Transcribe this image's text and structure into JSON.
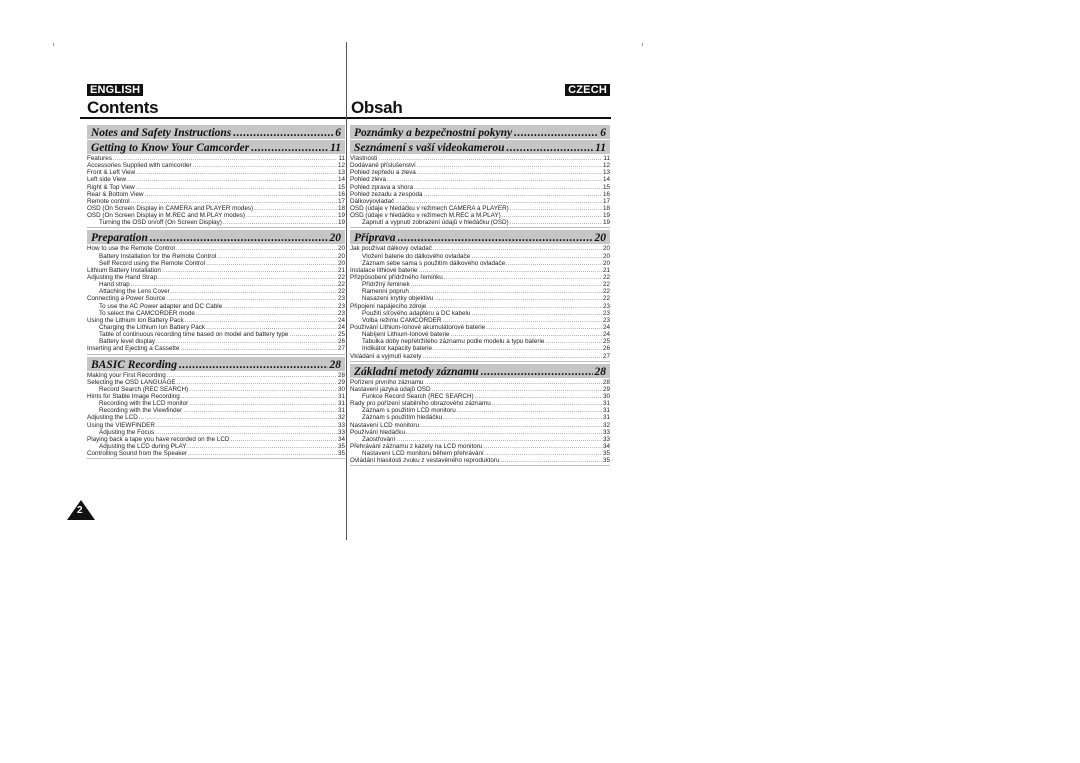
{
  "english": {
    "badge": "ENGLISH",
    "title": "Contents",
    "sections": [
      {
        "title": "Notes and Safety Instructions",
        "page": "6",
        "entries": []
      },
      {
        "title": "Getting to Know Your Camcorder",
        "page": "11",
        "entries": [
          {
            "text": "Features",
            "page": "11",
            "sub": false
          },
          {
            "text": "Accessories Supplied with camcorder",
            "page": "12",
            "sub": false
          },
          {
            "text": "Front & Left View",
            "page": "13",
            "sub": false
          },
          {
            "text": "Left side View",
            "page": "14",
            "sub": false
          },
          {
            "text": "Right & Top View",
            "page": "15",
            "sub": false
          },
          {
            "text": "Rear & Bottom View",
            "page": "16",
            "sub": false
          },
          {
            "text": "Remote control",
            "page": "17",
            "sub": false
          },
          {
            "text": "OSD (On Screen Display in CAMERA and PLAYER modes)",
            "page": "18",
            "sub": false
          },
          {
            "text": "OSD (On Screen Display in M.REC and M.PLAY modes)",
            "page": "19",
            "sub": false
          },
          {
            "text": "Turning the OSD on/off (On Screen Display)",
            "page": "19",
            "sub": true
          }
        ]
      },
      {
        "title": "Preparation",
        "page": "20",
        "entries": [
          {
            "text": "How to use the Remote Control",
            "page": "20",
            "sub": false
          },
          {
            "text": "Battery Installation for the Remote Control",
            "page": "20",
            "sub": true
          },
          {
            "text": "Self Record using the Remote Control",
            "page": "20",
            "sub": true
          },
          {
            "text": "Lithium Battery Installation",
            "page": "21",
            "sub": false
          },
          {
            "text": "Adjusting the Hand Strap",
            "page": "22",
            "sub": false
          },
          {
            "text": "Hand strap",
            "page": "22",
            "sub": true
          },
          {
            "text": "Attaching the Lens Cover",
            "page": "22",
            "sub": true
          },
          {
            "text": "Connecting a Power Source",
            "page": "23",
            "sub": false
          },
          {
            "text": "To use the AC Power adapter and DC Cable",
            "page": "23",
            "sub": true
          },
          {
            "text": "To select the CAMCORDER mode",
            "page": "23",
            "sub": true
          },
          {
            "text": "Using the Lithium Ion Battery Pack",
            "page": "24",
            "sub": false
          },
          {
            "text": "Charging the Lithium Ion Battery Pack",
            "page": "24",
            "sub": true
          },
          {
            "text": "Table of continuous recording time based on model and battery type",
            "page": "25",
            "sub": true
          },
          {
            "text": "Battery level display",
            "page": "26",
            "sub": true
          },
          {
            "text": "Inserting and Ejecting a Cassette",
            "page": "27",
            "sub": false
          }
        ]
      },
      {
        "title": "BASIC Recording",
        "page": "28",
        "entries": [
          {
            "text": "Making your First Recording",
            "page": "28",
            "sub": false
          },
          {
            "text": "Selecting the OSD LANGUAGE",
            "page": "29",
            "sub": false
          },
          {
            "text": "Record Search (REC SEARCH)",
            "page": "30",
            "sub": true
          },
          {
            "text": "Hints for Stable Image Recording",
            "page": "31",
            "sub": false
          },
          {
            "text": "Recording with the LCD monitor",
            "page": "31",
            "sub": true
          },
          {
            "text": "Recording with the Viewfinder",
            "page": "31",
            "sub": true
          },
          {
            "text": "Adjusting the LCD",
            "page": "32",
            "sub": false
          },
          {
            "text": "Using the VIEWFINDER",
            "page": "33",
            "sub": false
          },
          {
            "text": "Adjusting the Focus",
            "page": "33",
            "sub": true
          },
          {
            "text": "Playing back a tape you have recorded on the LCD",
            "page": "34",
            "sub": false
          },
          {
            "text": "Adjusting the LCD during PLAY",
            "page": "35",
            "sub": true
          },
          {
            "text": "Controlling Sound from the Speaker",
            "page": "35",
            "sub": false
          }
        ]
      }
    ]
  },
  "czech": {
    "badge": "CZECH",
    "title": "Obsah",
    "sections": [
      {
        "title": "Poznámky a bezpečnostní pokyny",
        "page": "6",
        "entries": []
      },
      {
        "title": "Seznámení s vaší videokamerou",
        "page": "11",
        "entries": [
          {
            "text": "Vlastnosti",
            "page": "11",
            "sub": false
          },
          {
            "text": "Dodávané příslušenství",
            "page": "12",
            "sub": false
          },
          {
            "text": "Pohled zepředu a zleva",
            "page": "13",
            "sub": false
          },
          {
            "text": "Pohled zleva",
            "page": "14",
            "sub": false
          },
          {
            "text": "Pohled zprava a shora",
            "page": "15",
            "sub": false
          },
          {
            "text": "Pohled zezadu a zespoda",
            "page": "16",
            "sub": false
          },
          {
            "text": "Dálkovýovladač",
            "page": "17",
            "sub": false
          },
          {
            "text": "OSD (údaje v hledáčku v režimech CAMERA a PLAYER)",
            "page": "18",
            "sub": false
          },
          {
            "text": "OSD (údaje v hledáčku v režimech M.REC a M.PLAY)",
            "page": "19",
            "sub": false
          },
          {
            "text": "Zapnutí a vypnutí zobrazení údajů v hledáčku (OSD)",
            "page": "19",
            "sub": true
          }
        ]
      },
      {
        "title": "Příprava",
        "page": "20",
        "entries": [
          {
            "text": "Jak používat dálkový ovladač",
            "page": "20",
            "sub": false
          },
          {
            "text": "Vložení baterie do dálkového ovladače",
            "page": "20",
            "sub": true
          },
          {
            "text": "Záznam sebe sama s použitím dálkového ovladače.",
            "page": "20",
            "sub": true
          },
          {
            "text": "Instalace lithiové baterie",
            "page": "21",
            "sub": false
          },
          {
            "text": "Přizpůsobení přídržného řeminku",
            "page": "22",
            "sub": false
          },
          {
            "text": "Přídržný řeminek",
            "page": "22",
            "sub": true
          },
          {
            "text": "Ramenní popruh",
            "page": "22",
            "sub": true
          },
          {
            "text": "Nasazení krytky objektivu",
            "page": "22",
            "sub": true
          },
          {
            "text": "Připojení napájecího zdroje",
            "page": "23",
            "sub": false
          },
          {
            "text": "Použití síťového adaptéru a DC kabelu",
            "page": "23",
            "sub": true
          },
          {
            "text": "Volba režimu CAMCORDER",
            "page": "23",
            "sub": true
          },
          {
            "text": "Používání Lithium-Ionové akumulátorové baterie",
            "page": "24",
            "sub": false
          },
          {
            "text": "Nabíjení Lithium-Ionové baterie",
            "page": "24",
            "sub": true
          },
          {
            "text": "Tabulka doby nepřetržitého záznamu podle modelu a typu baterie",
            "page": "25",
            "sub": true
          },
          {
            "text": "Indikátor kapacity baterie",
            "page": "26",
            "sub": true
          },
          {
            "text": "Vkládání a vyjmutí kazety",
            "page": "27",
            "sub": false
          }
        ]
      },
      {
        "title": "Základní metody záznamu",
        "page": "28",
        "entries": [
          {
            "text": "Pořízení prvního záznamu",
            "page": "28",
            "sub": false
          },
          {
            "text": "Nastavení jazyka údajů OSD",
            "page": "29",
            "sub": false
          },
          {
            "text": "Funkce Record Search (REC SEARCH)",
            "page": "30",
            "sub": true
          },
          {
            "text": "Rady pro pořízení stabilního obrazového záznamu",
            "page": "31",
            "sub": false
          },
          {
            "text": "Záznam s použitím LCD monitoru",
            "page": "31",
            "sub": true
          },
          {
            "text": "Záznam s použitím hledáčku",
            "page": "31",
            "sub": true
          },
          {
            "text": "Nastavení LCD monitoru",
            "page": "32",
            "sub": false
          },
          {
            "text": "Používání hledáčku",
            "page": "33",
            "sub": false
          },
          {
            "text": "Zaostřování",
            "page": "33",
            "sub": true
          },
          {
            "text": "Přehrávání záznamu z kazety na LCD monitoru",
            "page": "34",
            "sub": false
          },
          {
            "text": "Nastavení LCD monitoru během přehrávání",
            "page": "35",
            "sub": true
          },
          {
            "text": "Ovládání hlasitosti zvuku z vestavěného reproduktoru",
            "page": "35",
            "sub": false
          }
        ]
      }
    ]
  },
  "page_number": "2"
}
